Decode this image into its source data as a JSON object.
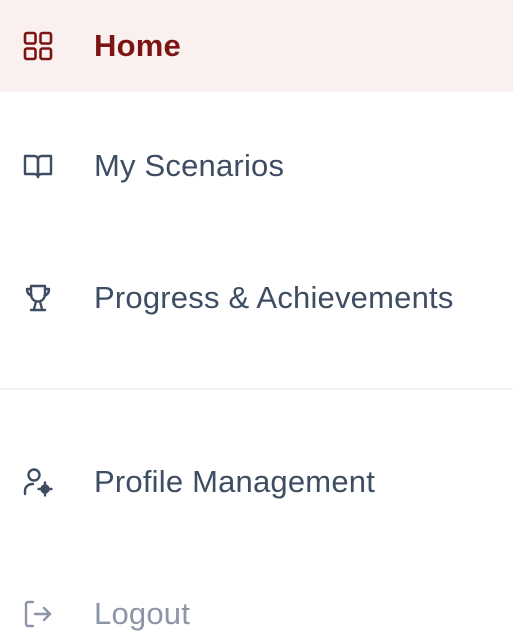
{
  "nav": {
    "items": [
      {
        "label": "Home",
        "icon": "grid-icon",
        "active": true
      },
      {
        "label": "My Scenarios",
        "icon": "book-open-icon"
      },
      {
        "label": "Progress & Achievements",
        "icon": "trophy-icon"
      },
      {
        "label": "Profile Management",
        "icon": "user-settings-icon"
      },
      {
        "label": "Logout",
        "icon": "logout-icon"
      }
    ]
  },
  "colors": {
    "active_text": "#7d1414",
    "active_background": "#f9f0ef",
    "text": "#3f4d63",
    "muted_text": "#8c96a6",
    "divider": "#eef0f3"
  }
}
